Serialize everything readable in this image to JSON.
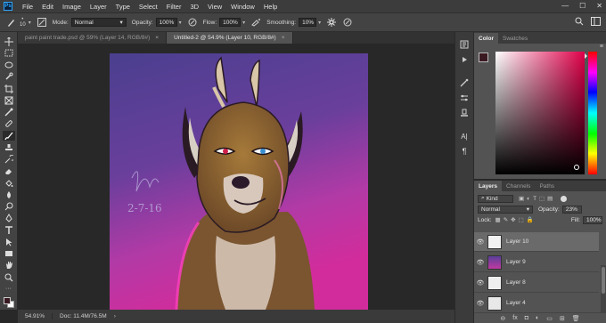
{
  "menubar": {
    "logo": "Ps",
    "items": [
      "File",
      "Edit",
      "Image",
      "Layer",
      "Type",
      "Select",
      "Filter",
      "3D",
      "View",
      "Window",
      "Help"
    ],
    "window_controls": [
      "—",
      "☐",
      "✕"
    ]
  },
  "options": {
    "brush_size": "10",
    "mode_label": "Mode:",
    "mode_value": "Normal",
    "opacity_label": "Opacity:",
    "opacity_value": "100%",
    "flow_label": "Flow:",
    "flow_value": "100%",
    "smoothing_label": "Smoothing:",
    "smoothing_value": "10%"
  },
  "tabs": [
    {
      "label": "paint paint trade.psd @ 59% (Layer 14, RGB/8#)",
      "close": "×"
    },
    {
      "label": "Untitled-2 @ 54.9% (Layer 10, RGB/8#)",
      "close": "×"
    }
  ],
  "status": {
    "zoom": "54.91%",
    "doc": "Doc: 11.4M/76.5M"
  },
  "color_panel": {
    "tabs": [
      "Color",
      "Swatches"
    ],
    "fg_color": "#3a1a22",
    "bg_color": "#ffffff"
  },
  "layers_panel": {
    "tabs": [
      "Layers",
      "Channels",
      "Paths"
    ],
    "kind_label": "Kind",
    "blend_mode": "Normal",
    "opacity_label": "Opacity:",
    "opacity_value": "23%",
    "lock_label": "Lock:",
    "fill_label": "Fill:",
    "fill_value": "100%",
    "layers": [
      {
        "name": "Layer 10",
        "selected": true
      },
      {
        "name": "Layer 9",
        "selected": false
      },
      {
        "name": "Layer 8",
        "selected": false
      },
      {
        "name": "Layer 4",
        "selected": false
      }
    ]
  },
  "artwork": {
    "signature_date": "2-7-16"
  }
}
